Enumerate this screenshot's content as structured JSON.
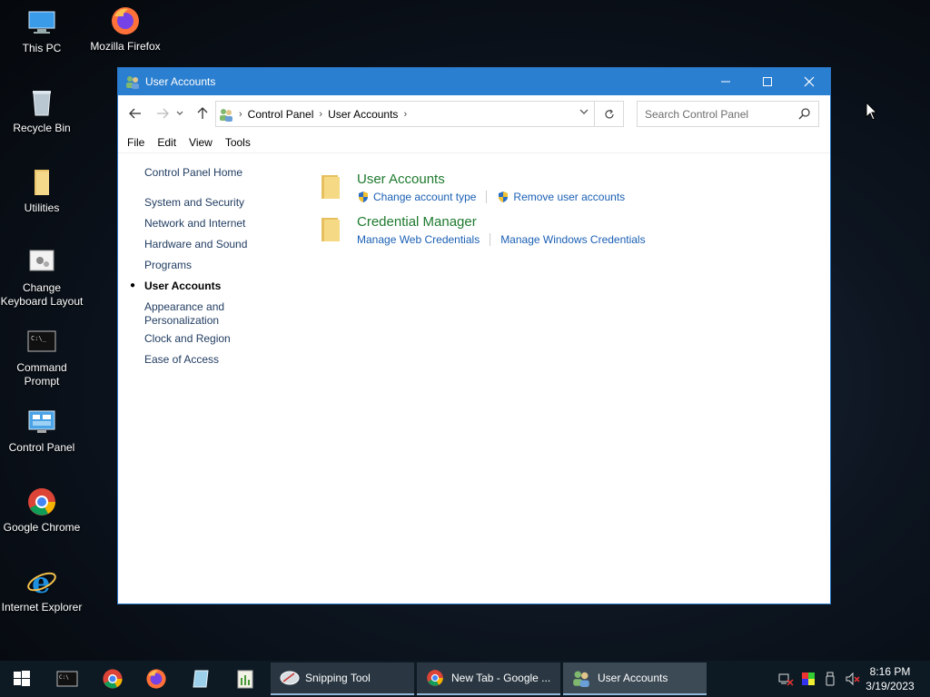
{
  "desktop": {
    "icons": [
      {
        "label": "This PC"
      },
      {
        "label": "Mozilla Firefox"
      },
      {
        "label": "Recycle Bin"
      },
      {
        "label": "Utilities"
      },
      {
        "label": "Change Keyboard Layout"
      },
      {
        "label": "Command Prompt"
      },
      {
        "label": "Control Panel"
      },
      {
        "label": "Google Chrome"
      },
      {
        "label": "Internet Explorer"
      }
    ]
  },
  "window": {
    "title": "User Accounts",
    "address": {
      "crumbs": [
        "Control Panel",
        "User Accounts"
      ]
    },
    "search": {
      "placeholder": "Search Control Panel"
    },
    "menu": [
      "File",
      "Edit",
      "View",
      "Tools"
    ],
    "sidebar": {
      "home": "Control Panel Home",
      "items": [
        "System and Security",
        "Network and Internet",
        "Hardware and Sound",
        "Programs",
        "User Accounts",
        "Appearance and Personalization",
        "Clock and Region",
        "Ease of Access"
      ]
    },
    "categories": [
      {
        "title": "User Accounts",
        "links": [
          "Change account type",
          "Remove user accounts"
        ]
      },
      {
        "title": "Credential Manager",
        "links": [
          "Manage Web Credentials",
          "Manage Windows Credentials"
        ]
      }
    ]
  },
  "taskbar": {
    "tasks": [
      "Snipping Tool",
      "New Tab - Google ...",
      "User Accounts"
    ],
    "clock": {
      "time": "8:16 PM",
      "date": "3/19/2023"
    }
  },
  "colors": {
    "titlebar": "#2b7fd0",
    "link": "#1a5fb4",
    "category_heading": "#1e7a2e"
  }
}
